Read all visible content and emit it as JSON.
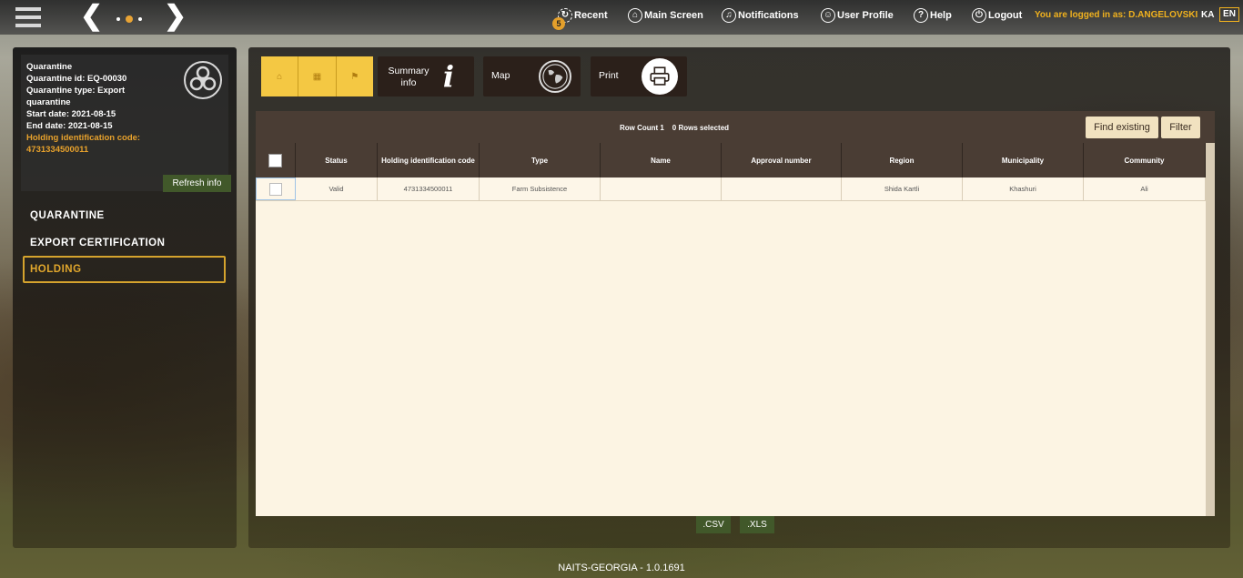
{
  "topbar": {
    "recent_label": "Recent",
    "recent_badge": "5",
    "main_screen_label": "Main Screen",
    "notifications_label": "Notifications",
    "user_profile_label": "User Profile",
    "help_label": "Help",
    "logout_label": "Logout",
    "logged_in_text": "You are logged in as: D.ANGELOVSKI",
    "lang_ka": "KA",
    "lang_en": "EN"
  },
  "info": {
    "line1": "Quarantine",
    "line2": "Quarantine id: EQ-00030",
    "line3": "Quarantine type: Export",
    "line4": "quarantine",
    "line5": "Start date: 2021-08-15",
    "line6": "End date: 2021-08-15",
    "line7": "Holding identification code:",
    "line8": "4731334500011",
    "refresh_label": "Refresh info"
  },
  "menu": {
    "item1": "QUARANTINE",
    "item2": "EXPORT CERTIFICATION",
    "item3": "HOLDING"
  },
  "toolbar": {
    "summary_label_1": "Summary",
    "summary_label_2": "info",
    "map_label": "Map",
    "print_label": "Print"
  },
  "grid": {
    "row_count": "Row Count 1",
    "rows_selected": "0 Rows selected",
    "find_existing_label": "Find existing",
    "filter_label": "Filter",
    "columns": {
      "status": "Status",
      "holding_code": "Holding identification code",
      "type": "Type",
      "name": "Name",
      "approval": "Approval number",
      "region": "Region",
      "municipality": "Municipality",
      "community": "Community"
    },
    "row1": {
      "status": "Valid",
      "holding_code": "4731334500011",
      "type": "Farm Subsistence",
      "name": "",
      "approval": "",
      "region": "Shida Kartli",
      "municipality": "Khashuri",
      "community": "Ali"
    }
  },
  "export": {
    "csv_label": ".CSV",
    "xls_label": ".XLS"
  },
  "footer": {
    "version": "NAITS-GEORGIA - 1.0.1691"
  },
  "colors": {
    "accent": "#f1b21e",
    "toolbar_yellow": "#f4c843",
    "dark_button": "#2b201a",
    "green_button": "#41582a"
  }
}
